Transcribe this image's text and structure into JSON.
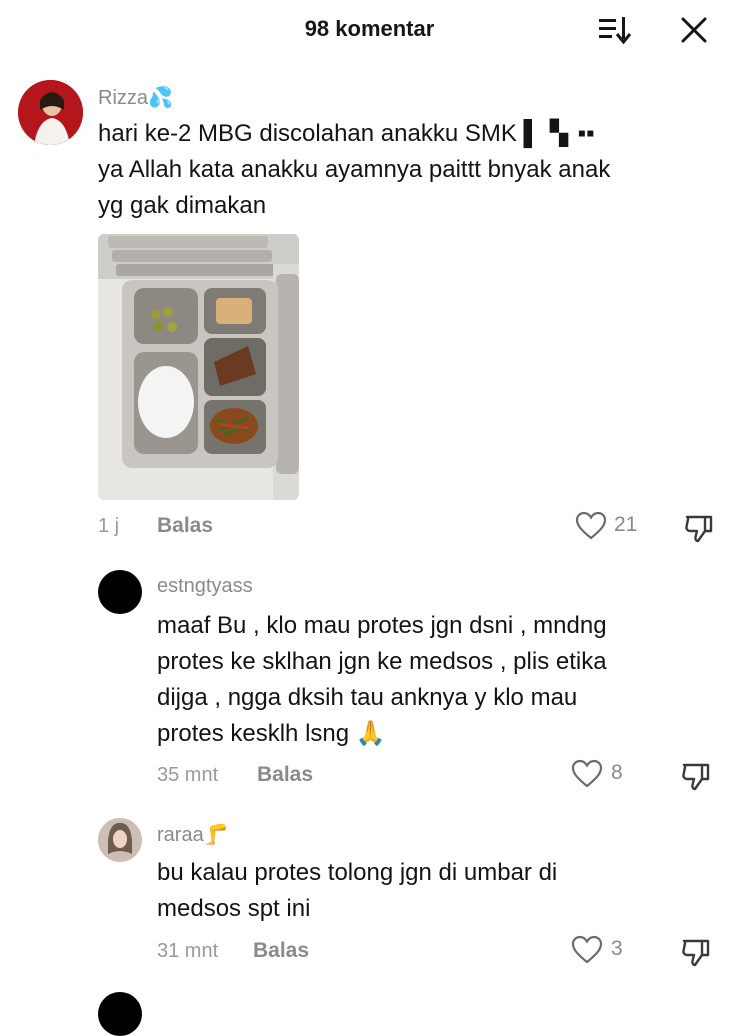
{
  "header": {
    "title": "98 komentar",
    "sort_icon": "sort-icon",
    "close_icon": "close-icon"
  },
  "comments": [
    {
      "username": "Rizza💦",
      "lines": [
        "hari ke-2 MBG discolahan anakku SMK ▌▝▖▪▪",
        "ya Allah kata anakku ayamnya paittt bnyak anak",
        "yg gak dimakan"
      ],
      "time": "1 j",
      "reply_label": "Balas",
      "likes": "21",
      "has_photo": true
    },
    {
      "username": "estngtyass",
      "lines": [
        "maaf Bu , klo mau protes jgn dsni , mndng",
        "protes ke sklhan jgn ke medsos , plis etika",
        "dijga , ngga dksih tau anknya y klo mau",
        "protes kesklh lsng 🙏"
      ],
      "time": "35 mnt",
      "reply_label": "Balas",
      "likes": "8"
    },
    {
      "username": "raraa🦵",
      "lines": [
        "bu kalau protes tolong jgn di umbar di",
        "medsos spt ini"
      ],
      "time": "31 mnt",
      "reply_label": "Balas",
      "likes": "3"
    }
  ],
  "colors": {
    "text": "#141414",
    "muted": "#8a8a8a",
    "background": "#ffffff"
  }
}
